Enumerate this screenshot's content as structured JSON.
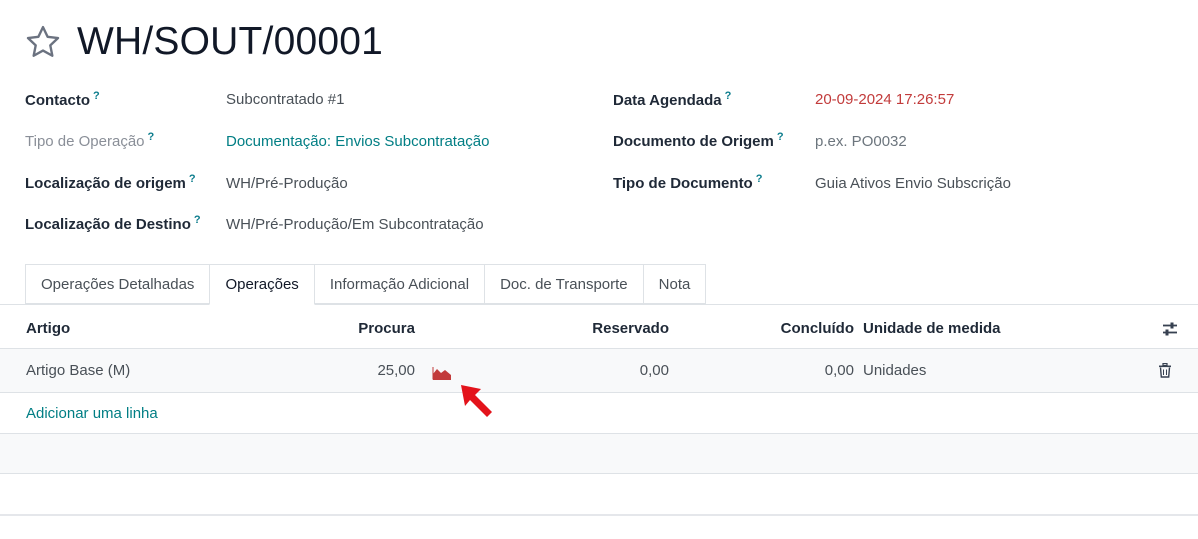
{
  "record": {
    "title": "WH/SOUT/00001"
  },
  "fields_left": [
    {
      "label": "Contacto",
      "help": "?",
      "value": "Subcontratado #1"
    },
    {
      "label": "Tipo de Operação",
      "help": "?",
      "value": "Documentação: Envios Subcontratação"
    },
    {
      "label": "Localização de origem",
      "help": "?",
      "value": "WH/Pré-Produção"
    },
    {
      "label": "Localização de Destino",
      "help": "?",
      "value": "WH/Pré-Produção/Em Subcontratação"
    }
  ],
  "fields_right": [
    {
      "label": "Data Agendada",
      "help": "?",
      "value": "20-09-2024 17:26:57"
    },
    {
      "label": "Documento de Origem",
      "help": "?",
      "placeholder": "p.ex. PO0032"
    },
    {
      "label": "Tipo de Documento",
      "help": "?",
      "value": "Guia Ativos Envio Subscrição"
    }
  ],
  "tabs": [
    "Operações Detalhadas",
    "Operações",
    "Informação Adicional",
    "Doc. de Transporte",
    "Nota"
  ],
  "active_tab": "Operações",
  "table": {
    "headers": {
      "artigo": "Artigo",
      "procura": "Procura",
      "reservado": "Reservado",
      "concluido": "Concluído",
      "unidade": "Unidade de medida"
    },
    "rows": [
      {
        "artigo": "Artigo Base (M)",
        "procura": "25,00",
        "reservado": "0,00",
        "concluido": "0,00",
        "unidade": "Unidades"
      }
    ],
    "add_line": "Adicionar uma linha"
  },
  "icons": {
    "favorite": "star-outline-icon",
    "forecast": "area-chart-icon",
    "columns": "sliders-icon",
    "delete": "trash-icon",
    "annotation": "arrow-pointer-icon"
  },
  "colors": {
    "accent": "#017e84",
    "date_warning": "#c23b3b",
    "forecast_icon": "#c23b3b",
    "annotation_arrow": "#e3131b"
  }
}
